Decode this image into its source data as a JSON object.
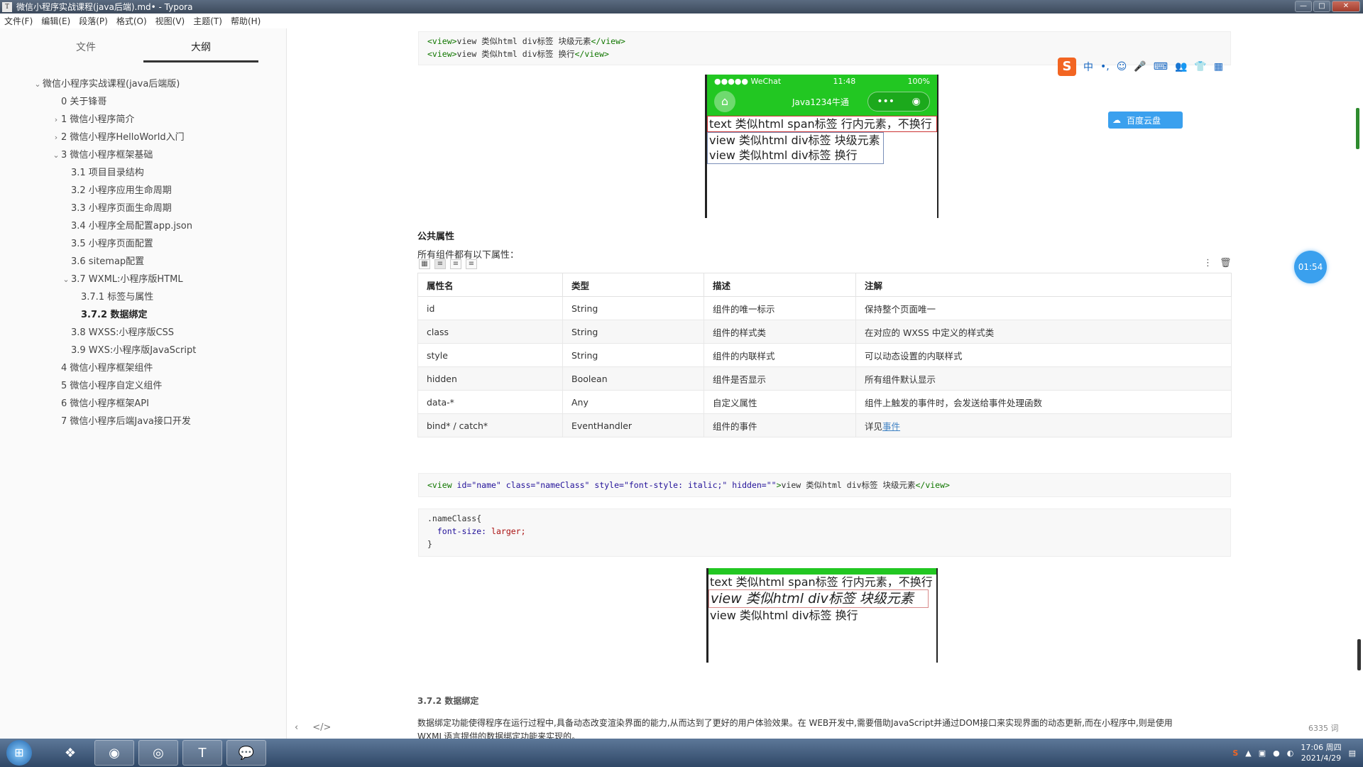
{
  "window": {
    "title": "微信小程序实战课程(java后端).md• - Typora",
    "app_icon": "T",
    "controls": [
      "—",
      "□",
      "✕"
    ]
  },
  "menu": [
    "文件(F)",
    "编辑(E)",
    "段落(P)",
    "格式(O)",
    "视图(V)",
    "主题(T)",
    "帮助(H)"
  ],
  "sidebar": {
    "tabs": [
      {
        "label": "文件",
        "active": false
      },
      {
        "label": "大纲",
        "active": true
      }
    ],
    "outline": [
      {
        "label": "微信小程序实战课程(java后端版)",
        "level": 0,
        "chevron": "⌄"
      },
      {
        "label": "0 关于锋哥",
        "level": 1,
        "chevron": ""
      },
      {
        "label": "1 微信小程序简介",
        "level": 1,
        "chevron": "›"
      },
      {
        "label": "2 微信小程序HelloWorld入门",
        "level": 1,
        "chevron": "›"
      },
      {
        "label": "3 微信小程序框架基础",
        "level": 1,
        "chevron": "⌄"
      },
      {
        "label": "3.1 项目目录结构",
        "level": 2,
        "chevron": ""
      },
      {
        "label": "3.2 小程序应用生命周期",
        "level": 2,
        "chevron": ""
      },
      {
        "label": "3.3 小程序页面生命周期",
        "level": 2,
        "chevron": ""
      },
      {
        "label": "3.4 小程序全局配置app.json",
        "level": 2,
        "chevron": ""
      },
      {
        "label": "3.5 小程序页面配置",
        "level": 2,
        "chevron": ""
      },
      {
        "label": "3.6 sitemap配置",
        "level": 2,
        "chevron": ""
      },
      {
        "label": "3.7 WXML:小程序版HTML",
        "level": 2,
        "chevron": "⌄"
      },
      {
        "label": "3.7.1 标签与属性",
        "level": 3,
        "chevron": ""
      },
      {
        "label": "3.7.2 数据绑定",
        "level": 3,
        "chevron": "",
        "active": true
      },
      {
        "label": "3.8 WXSS:小程序版CSS",
        "level": 2,
        "chevron": ""
      },
      {
        "label": "3.9 WXS:小程序版JavaScript",
        "level": 2,
        "chevron": ""
      },
      {
        "label": "4 微信小程序框架组件",
        "level": 1,
        "chevron": ""
      },
      {
        "label": "5 微信小程序自定义组件",
        "level": 1,
        "chevron": ""
      },
      {
        "label": "6 微信小程序框架API",
        "level": 1,
        "chevron": ""
      },
      {
        "label": "7 微信小程序后端Java接口开发",
        "level": 1,
        "chevron": ""
      }
    ]
  },
  "editor": {
    "code_top": {
      "line1": {
        "open": "<view>",
        "text": "view 类似html div标签 块级元素",
        "close": "</view>"
      },
      "line2": {
        "open": "<view>",
        "text": "view 类似html div标签 换行",
        "close": "</view>"
      }
    },
    "phone1": {
      "status_left": "●●●●● WeChat",
      "status_time": "11:48",
      "status_right": "100%",
      "nav_title": "Java1234牛通",
      "capsule_dots": "•••",
      "capsule_target": "◉",
      "home_icon": "⌂",
      "lines": [
        "text 类似html span标签 行内元素，不换行",
        "view 类似html div标签 块级元素",
        "view 类似html div标签 换行"
      ]
    },
    "section_title": "公共属性",
    "section_intro": "所有组件都有以下属性：",
    "table": {
      "headers": [
        "属性名",
        "类型",
        "描述",
        "注解"
      ],
      "rows": [
        [
          "id",
          "String",
          "组件的唯一标示",
          "保持整个页面唯一"
        ],
        [
          "class",
          "String",
          "组件的样式类",
          "在对应的 WXSS 中定义的样式类"
        ],
        [
          "style",
          "String",
          "组件的内联样式",
          "可以动态设置的内联样式"
        ],
        [
          "hidden",
          "Boolean",
          "组件是否显示",
          "所有组件默认显示"
        ],
        [
          "data-*",
          "Any",
          "自定义属性",
          "组件上触发的事件时，会发送给事件处理函数"
        ],
        [
          "bind* / catch*",
          "EventHandler",
          "组件的事件",
          "详见"
        ]
      ],
      "last_link": "事件"
    },
    "code_mid": {
      "tag_open": "<view",
      "attrs": " id=\"name\" class=\"nameClass\" style=\"font-style: italic;\" hidden=\"\"",
      "gt": ">",
      "text": "view 类似html div标签 块级元素",
      "close": "</view>"
    },
    "code_css": {
      "line1": ".nameClass{",
      "line2_prop": "font-size:",
      "line2_val": "larger;",
      "line3": "}"
    },
    "phone2": {
      "lines": [
        "text 类似html span标签 行内元素，不换行",
        "view 类似html div标签 块级元素",
        "view 类似html div标签 换行"
      ]
    },
    "subheading": "3.7.2 数据绑定",
    "paragraph": "数据绑定功能使得程序在运行过程中,具备动态改变渲染界面的能力,从而达到了更好的用户体验效果。在 WEB开发中,需要借助JavaScript并通过DOM接口来实现界面的动态更新,而在小程序中,则是使用",
    "paragraph2": "WXML语言提供的数据绑定功能来实现的。",
    "word_count": "6335 词",
    "src_left": "‹",
    "src_code": "</>"
  },
  "widgets": {
    "ime": {
      "logo": "S",
      "items": [
        "中",
        "•,",
        "☺",
        "🎤",
        "⌨",
        "👥",
        "👕",
        "▦"
      ]
    },
    "cloud_label": "百度云盘",
    "timer": "01:54",
    "table_more": "⋮",
    "table_delete": "🗑"
  },
  "taskbar": {
    "start": "⊞",
    "apps": [
      {
        "name": "taskbar-app-colorful",
        "glyph": "❖",
        "open": false
      },
      {
        "name": "taskbar-app-browser",
        "glyph": "◉",
        "open": true
      },
      {
        "name": "taskbar-app-chrome",
        "glyph": "◎",
        "open": true
      },
      {
        "name": "taskbar-app-typora",
        "glyph": "T",
        "open": true
      },
      {
        "name": "taskbar-app-wechat",
        "glyph": "💬",
        "open": true
      }
    ],
    "time": "17:06 周四",
    "date": "2021/4/29"
  }
}
